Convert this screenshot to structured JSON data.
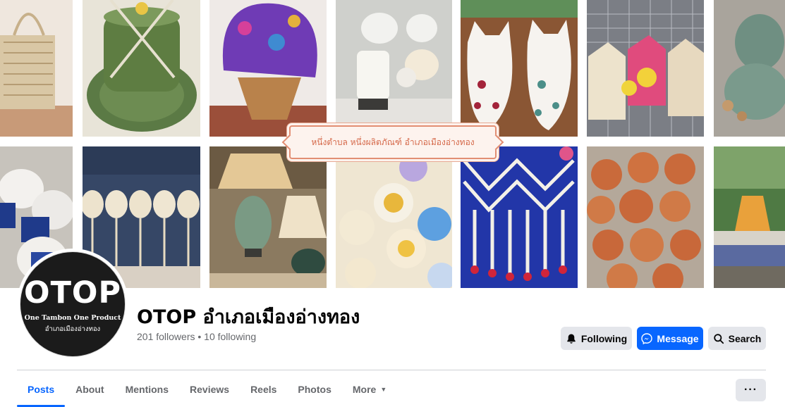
{
  "cover": {
    "banner_text": "หนึ่งตำบล หนึ่งผลิตภัณฑ์ อำเภอเมืองอ่างทอง",
    "photos": [
      "woven-basket",
      "green-ceramic-cup",
      "purple-bucket-hat",
      "white-ceramic-lamps",
      "ceramic-cats",
      "crochet-bags",
      "celadon-ganesha",
      "ceramic-elephants",
      "paper-umbrellas",
      "celadon-table-lamp",
      "clay-flowers",
      "flower-garland",
      "baked-pastries",
      "outdoor-cafe"
    ]
  },
  "profile": {
    "avatar": {
      "logo_word": "OTOP",
      "logo_tagline": "One Tambon One Product",
      "logo_thai": "อำเภอเมืองอ่างทอง"
    },
    "name": "OTOP อำเภอเมืองอ่างทอง",
    "stats": "201 followers • 10 following"
  },
  "actions": {
    "following_label": "Following",
    "message_label": "Message",
    "search_label": "Search"
  },
  "tabs": [
    {
      "label": "Posts",
      "active": true
    },
    {
      "label": "About"
    },
    {
      "label": "Mentions"
    },
    {
      "label": "Reviews"
    },
    {
      "label": "Reels"
    },
    {
      "label": "Photos"
    },
    {
      "label": "More"
    }
  ],
  "more_options_label": "···",
  "colors": {
    "accent": "#0866ff",
    "button_gray": "#e4e6eb",
    "secondary_text": "#65676b",
    "banner_border": "#e28e73"
  },
  "icons": {
    "following": "bell-icon",
    "message": "messenger-icon",
    "search": "search-icon",
    "more_tab": "caret-down-icon"
  }
}
